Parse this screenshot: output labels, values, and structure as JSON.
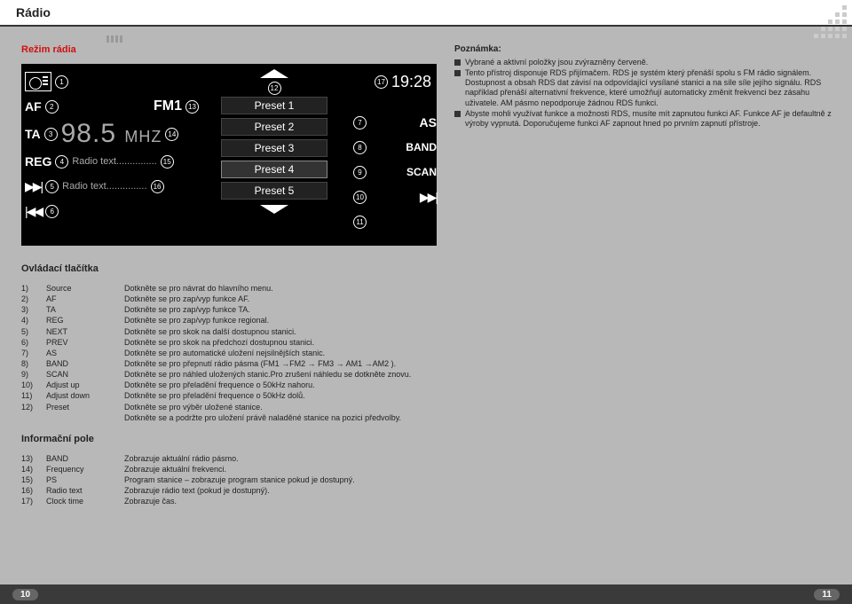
{
  "header": {
    "title": "Rádio"
  },
  "mode_section": {
    "title": "Režim rádia"
  },
  "radio": {
    "band": "FM1",
    "freq": "98.5",
    "freq_unit": "MHZ",
    "radio_text_1": "Radio text...............",
    "radio_text_2": "Radio text...............",
    "time": "19:28",
    "btn_af": "AF",
    "btn_ta": "TA",
    "btn_reg": "REG",
    "btn_as": "AS",
    "btn_band": "BAND",
    "btn_scan": "SCAN",
    "presets": [
      "Preset 1",
      "Preset 2",
      "Preset 3",
      "Preset 4",
      "Preset 5"
    ],
    "callouts": {
      "c1": "1",
      "c2": "2",
      "c3": "3",
      "c4": "4",
      "c5": "5",
      "c6": "6",
      "c7": "7",
      "c8": "8",
      "c9": "9",
      "c10": "10",
      "c11": "11",
      "c12": "12",
      "c13": "13",
      "c14": "14",
      "c15": "15",
      "c16": "16",
      "c17": "17"
    }
  },
  "note": {
    "title": "Poznámka:",
    "items": [
      "Vybrané a aktivní položky jsou zvýrazněny červeně.",
      "Tento přístroj disponuje RDS přijímačem. RDS je systém který přenáší spolu s FM rádio signálem. Dostupnost a obsah RDS dat závisí na odpovídající vysílané stanici a na síle síle jejího signálu. RDS například přenáší alternativní frekvence, které umožňují automaticky změnit frekvenci bez zásahu uživatele. AM pásmo nepodporuje žádnou RDS funkci.",
      "Abyste mohli využívat funkce a možnosti RDS, musíte mít zapnutou funkci AF. Funkce AF je defaultně z výroby vypnutá. Doporučujeme funkci AF zapnout hned po prvním zapnutí přístroje."
    ]
  },
  "controls": {
    "title": "Ovládací tlačítka",
    "rows": [
      {
        "n": "1)",
        "name": "Source",
        "desc": "Dotkněte se pro návrat do hlavního menu."
      },
      {
        "n": "2)",
        "name": "AF",
        "desc": "Dotkněte se pro zap/vyp funkce AF."
      },
      {
        "n": "3)",
        "name": "TA",
        "desc": "Dotkněte se pro zap/vyp funkce TA."
      },
      {
        "n": "4)",
        "name": "REG",
        "desc": "Dotkněte se pro zap/vyp funkce regional."
      },
      {
        "n": "5)",
        "name": "NEXT",
        "desc": "Dotkněte se pro skok na další dostupnou stanici."
      },
      {
        "n": "6)",
        "name": "PREV",
        "desc": "Dotkněte se pro skok na předchozí dostupnou stanici."
      },
      {
        "n": "7)",
        "name": "AS",
        "desc": "Dotkněte se pro automatické uložení nejsilnějších stanic."
      },
      {
        "n": "8)",
        "name": "BAND",
        "desc": "Dotkněte se pro přepnutí rádio pásma (FM1 →FM2 → FM3 → AM1 →AM2 )."
      },
      {
        "n": "9)",
        "name": "SCAN",
        "desc": "Dotkněte se pro náhled uložených stanic.Pro zrušení náhledu se dotkněte znovu."
      },
      {
        "n": "10)",
        "name": "Adjust up",
        "desc": "Dotkněte se pro přeladění frequence o 50kHz nahoru."
      },
      {
        "n": "11)",
        "name": "Adjust down",
        "desc": "Dotkněte se pro přeladění frequence o 50kHz dolů."
      },
      {
        "n": "12)",
        "name": "Preset",
        "desc": "Dotkněte se pro výběr uložené stanice."
      },
      {
        "n": "",
        "name": "",
        "desc": "Dotkněte se a podržte pro uložení právě naladěné stanice na pozici předvolby."
      }
    ]
  },
  "info": {
    "title": "Informační pole",
    "rows": [
      {
        "n": "13)",
        "name": "BAND",
        "desc": "Zobrazuje aktuální rádio pásmo."
      },
      {
        "n": "14)",
        "name": "Frequency",
        "desc": "Zobrazuje aktuální frekvenci."
      },
      {
        "n": "15)",
        "name": "PS",
        "desc": "Program stanice – zobrazuje program stanice pokud je dostupný."
      },
      {
        "n": "16)",
        "name": "Radio text",
        "desc": "Zobrazuje rádio text (pokud je dostupný)."
      },
      {
        "n": "17)",
        "name": "Clock time",
        "desc": "Zobrazuje čas."
      }
    ]
  },
  "footer": {
    "left": "10",
    "right": "11"
  }
}
